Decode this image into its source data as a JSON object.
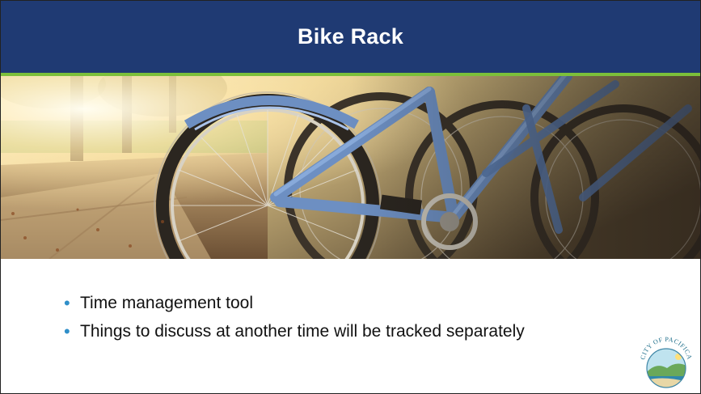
{
  "slide": {
    "title": "Bike Rack",
    "bullets": [
      "Time management tool",
      "Things to discuss at another time will be tracked separately"
    ]
  },
  "logo": {
    "text": "CITY OF PACIFICA",
    "icon": "city-seal-icon"
  },
  "image": {
    "subject": "bicycle-rack-photo"
  },
  "colors": {
    "header": "#1f3a73",
    "accent": "#7cbf3a",
    "bullet": "#2f8fc9",
    "title_text": "#ffffff"
  }
}
